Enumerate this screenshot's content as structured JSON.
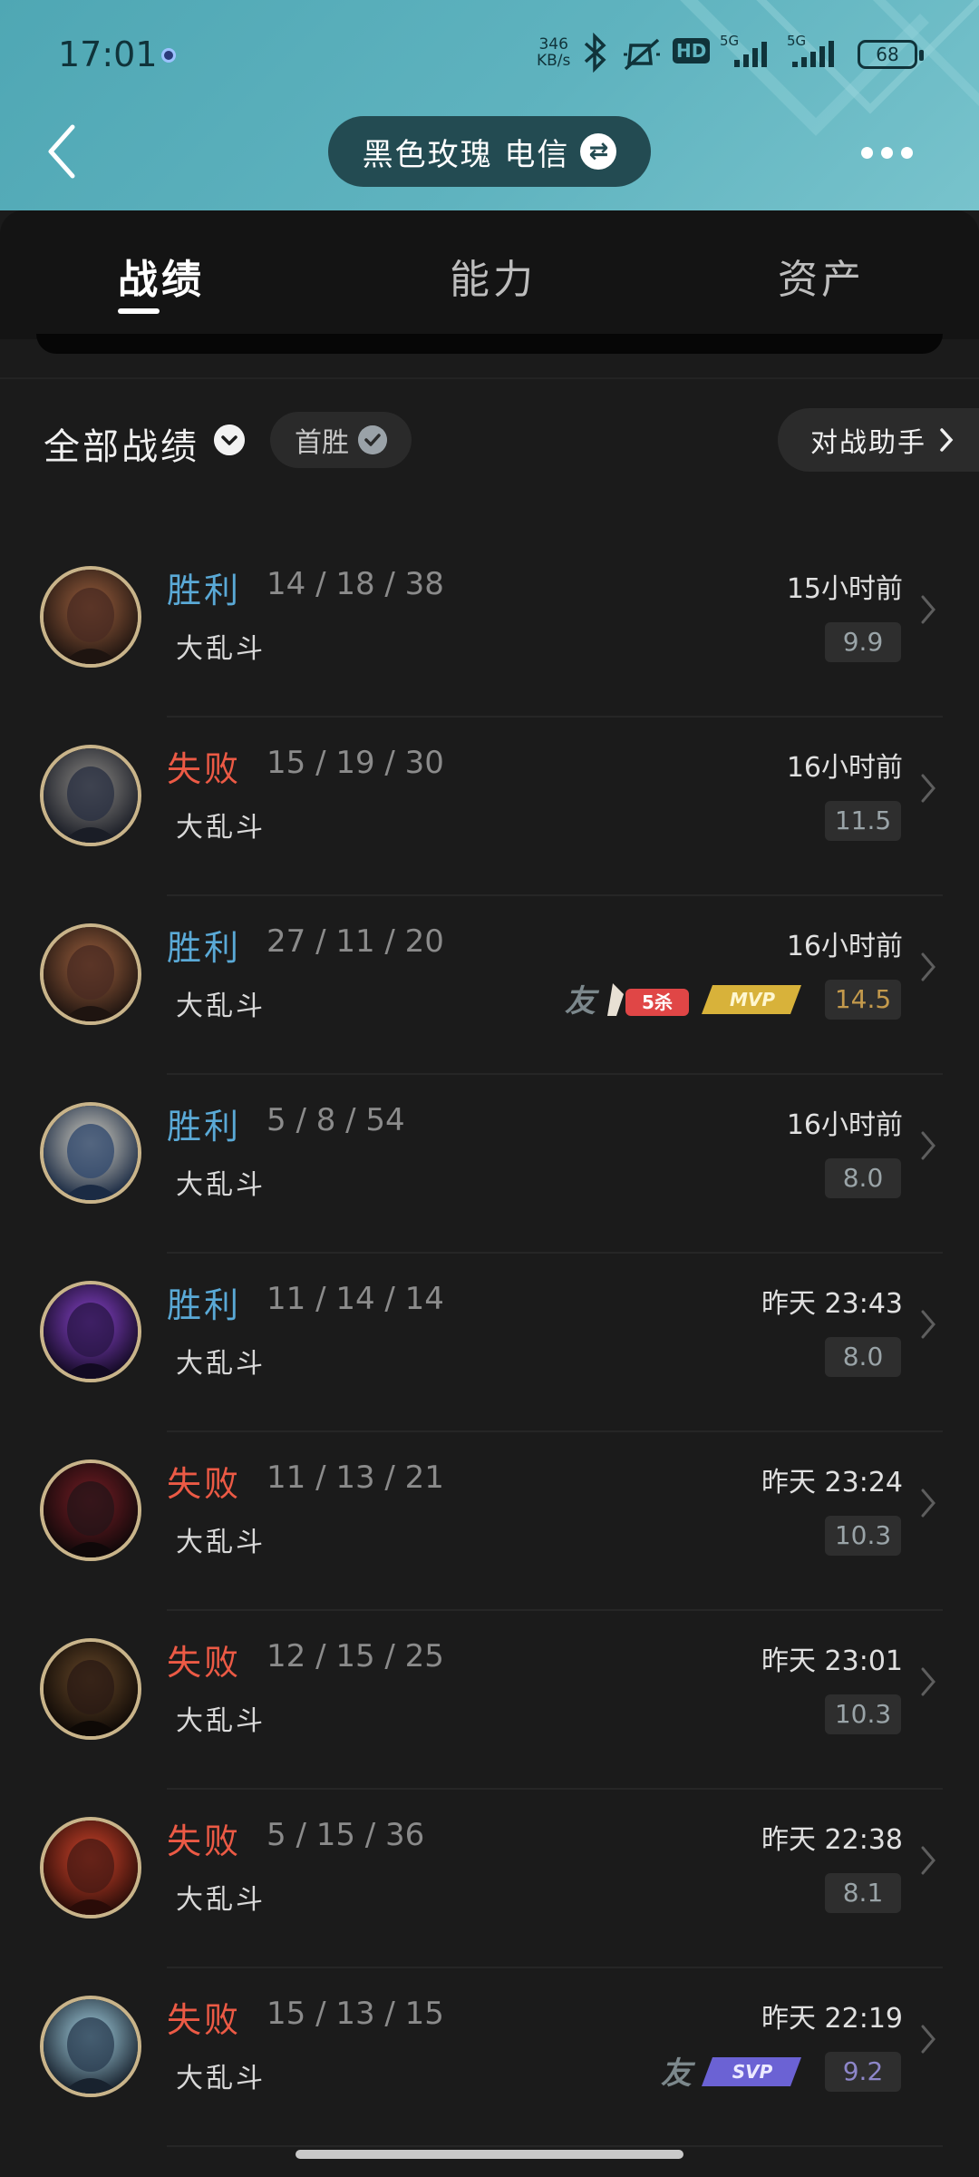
{
  "status_bar": {
    "time": "17:01",
    "net_speed": "346",
    "net_unit": "KB/s",
    "sig1_tag": "5G",
    "sig2_tag": "5G",
    "hd": "HD",
    "battery": "68"
  },
  "header": {
    "account": "黑色玫瑰 电信",
    "swap_symbol": "⇄"
  },
  "tabs": [
    {
      "label": "战绩",
      "active": true
    },
    {
      "label": "能力",
      "active": false
    },
    {
      "label": "资产",
      "active": false
    }
  ],
  "filter": {
    "title": "全部战绩",
    "chip": "首胜",
    "assistant": "对战助手"
  },
  "friend_label": "友",
  "badges": {
    "five_kill": "5杀",
    "mvp": "MVP",
    "svp": "SVP"
  },
  "matches": [
    {
      "result": "胜利",
      "win": true,
      "kda": "14 / 18 / 38",
      "mode": "大乱斗",
      "time": "15小时前",
      "score": "9.9",
      "badge": null
    },
    {
      "result": "失败",
      "win": false,
      "kda": "15 / 19 / 30",
      "mode": "大乱斗",
      "time": "16小时前",
      "score": "11.5",
      "badge": null
    },
    {
      "result": "胜利",
      "win": true,
      "kda": "27 / 11 / 20",
      "mode": "大乱斗",
      "time": "16小时前",
      "score": "14.5",
      "badge": "mvp"
    },
    {
      "result": "胜利",
      "win": true,
      "kda": "5 / 8 / 54",
      "mode": "大乱斗",
      "time": "16小时前",
      "score": "8.0",
      "badge": null
    },
    {
      "result": "胜利",
      "win": true,
      "kda": "11 / 14 / 14",
      "mode": "大乱斗",
      "time": "昨天 23:43",
      "score": "8.0",
      "badge": null
    },
    {
      "result": "失败",
      "win": false,
      "kda": "11 / 13 / 21",
      "mode": "大乱斗",
      "time": "昨天 23:24",
      "score": "10.3",
      "badge": null
    },
    {
      "result": "失败",
      "win": false,
      "kda": "12 / 15 / 25",
      "mode": "大乱斗",
      "time": "昨天 23:01",
      "score": "10.3",
      "badge": null
    },
    {
      "result": "失败",
      "win": false,
      "kda": "5 / 15 / 36",
      "mode": "大乱斗",
      "time": "昨天 22:38",
      "score": "8.1",
      "badge": null
    },
    {
      "result": "失败",
      "win": false,
      "kda": "15 / 13 / 15",
      "mode": "大乱斗",
      "time": "昨天 22:19",
      "score": "9.2",
      "badge": "svp"
    }
  ],
  "colors": {
    "win": "#5aa9d6",
    "loss": "#ec5a45",
    "header_bg": "#5fb3bf",
    "panel_bg": "#1b1b1b"
  }
}
